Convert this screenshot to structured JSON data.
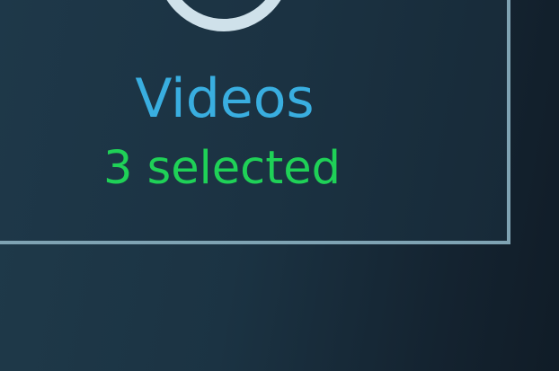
{
  "card": {
    "icon": "play-circle-icon",
    "title": "Videos",
    "status": "3 selected"
  },
  "colors": {
    "title": "#39aee0",
    "status": "#1fd157",
    "border": "#7fa3b3",
    "icon": "#cfe1ea"
  }
}
